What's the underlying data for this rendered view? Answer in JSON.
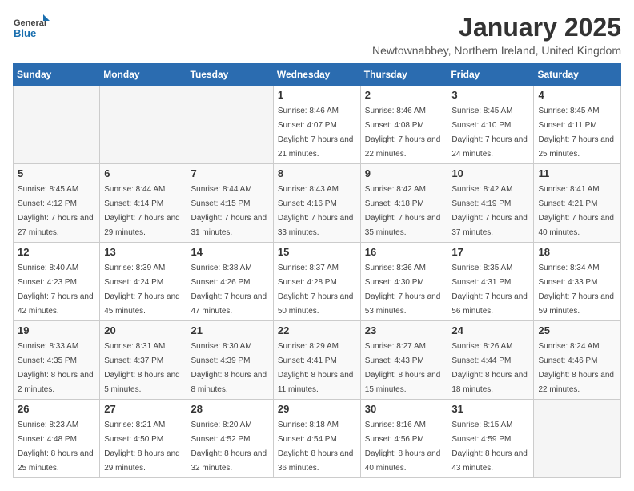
{
  "logo": {
    "general": "General",
    "blue": "Blue"
  },
  "title": "January 2025",
  "subtitle": "Newtownabbey, Northern Ireland, United Kingdom",
  "days_of_week": [
    "Sunday",
    "Monday",
    "Tuesday",
    "Wednesday",
    "Thursday",
    "Friday",
    "Saturday"
  ],
  "weeks": [
    [
      {
        "day": "",
        "sunrise": "",
        "sunset": "",
        "daylight": ""
      },
      {
        "day": "",
        "sunrise": "",
        "sunset": "",
        "daylight": ""
      },
      {
        "day": "",
        "sunrise": "",
        "sunset": "",
        "daylight": ""
      },
      {
        "day": "1",
        "sunrise": "Sunrise: 8:46 AM",
        "sunset": "Sunset: 4:07 PM",
        "daylight": "Daylight: 7 hours and 21 minutes."
      },
      {
        "day": "2",
        "sunrise": "Sunrise: 8:46 AM",
        "sunset": "Sunset: 4:08 PM",
        "daylight": "Daylight: 7 hours and 22 minutes."
      },
      {
        "day": "3",
        "sunrise": "Sunrise: 8:45 AM",
        "sunset": "Sunset: 4:10 PM",
        "daylight": "Daylight: 7 hours and 24 minutes."
      },
      {
        "day": "4",
        "sunrise": "Sunrise: 8:45 AM",
        "sunset": "Sunset: 4:11 PM",
        "daylight": "Daylight: 7 hours and 25 minutes."
      }
    ],
    [
      {
        "day": "5",
        "sunrise": "Sunrise: 8:45 AM",
        "sunset": "Sunset: 4:12 PM",
        "daylight": "Daylight: 7 hours and 27 minutes."
      },
      {
        "day": "6",
        "sunrise": "Sunrise: 8:44 AM",
        "sunset": "Sunset: 4:14 PM",
        "daylight": "Daylight: 7 hours and 29 minutes."
      },
      {
        "day": "7",
        "sunrise": "Sunrise: 8:44 AM",
        "sunset": "Sunset: 4:15 PM",
        "daylight": "Daylight: 7 hours and 31 minutes."
      },
      {
        "day": "8",
        "sunrise": "Sunrise: 8:43 AM",
        "sunset": "Sunset: 4:16 PM",
        "daylight": "Daylight: 7 hours and 33 minutes."
      },
      {
        "day": "9",
        "sunrise": "Sunrise: 8:42 AM",
        "sunset": "Sunset: 4:18 PM",
        "daylight": "Daylight: 7 hours and 35 minutes."
      },
      {
        "day": "10",
        "sunrise": "Sunrise: 8:42 AM",
        "sunset": "Sunset: 4:19 PM",
        "daylight": "Daylight: 7 hours and 37 minutes."
      },
      {
        "day": "11",
        "sunrise": "Sunrise: 8:41 AM",
        "sunset": "Sunset: 4:21 PM",
        "daylight": "Daylight: 7 hours and 40 minutes."
      }
    ],
    [
      {
        "day": "12",
        "sunrise": "Sunrise: 8:40 AM",
        "sunset": "Sunset: 4:23 PM",
        "daylight": "Daylight: 7 hours and 42 minutes."
      },
      {
        "day": "13",
        "sunrise": "Sunrise: 8:39 AM",
        "sunset": "Sunset: 4:24 PM",
        "daylight": "Daylight: 7 hours and 45 minutes."
      },
      {
        "day": "14",
        "sunrise": "Sunrise: 8:38 AM",
        "sunset": "Sunset: 4:26 PM",
        "daylight": "Daylight: 7 hours and 47 minutes."
      },
      {
        "day": "15",
        "sunrise": "Sunrise: 8:37 AM",
        "sunset": "Sunset: 4:28 PM",
        "daylight": "Daylight: 7 hours and 50 minutes."
      },
      {
        "day": "16",
        "sunrise": "Sunrise: 8:36 AM",
        "sunset": "Sunset: 4:30 PM",
        "daylight": "Daylight: 7 hours and 53 minutes."
      },
      {
        "day": "17",
        "sunrise": "Sunrise: 8:35 AM",
        "sunset": "Sunset: 4:31 PM",
        "daylight": "Daylight: 7 hours and 56 minutes."
      },
      {
        "day": "18",
        "sunrise": "Sunrise: 8:34 AM",
        "sunset": "Sunset: 4:33 PM",
        "daylight": "Daylight: 7 hours and 59 minutes."
      }
    ],
    [
      {
        "day": "19",
        "sunrise": "Sunrise: 8:33 AM",
        "sunset": "Sunset: 4:35 PM",
        "daylight": "Daylight: 8 hours and 2 minutes."
      },
      {
        "day": "20",
        "sunrise": "Sunrise: 8:31 AM",
        "sunset": "Sunset: 4:37 PM",
        "daylight": "Daylight: 8 hours and 5 minutes."
      },
      {
        "day": "21",
        "sunrise": "Sunrise: 8:30 AM",
        "sunset": "Sunset: 4:39 PM",
        "daylight": "Daylight: 8 hours and 8 minutes."
      },
      {
        "day": "22",
        "sunrise": "Sunrise: 8:29 AM",
        "sunset": "Sunset: 4:41 PM",
        "daylight": "Daylight: 8 hours and 11 minutes."
      },
      {
        "day": "23",
        "sunrise": "Sunrise: 8:27 AM",
        "sunset": "Sunset: 4:43 PM",
        "daylight": "Daylight: 8 hours and 15 minutes."
      },
      {
        "day": "24",
        "sunrise": "Sunrise: 8:26 AM",
        "sunset": "Sunset: 4:44 PM",
        "daylight": "Daylight: 8 hours and 18 minutes."
      },
      {
        "day": "25",
        "sunrise": "Sunrise: 8:24 AM",
        "sunset": "Sunset: 4:46 PM",
        "daylight": "Daylight: 8 hours and 22 minutes."
      }
    ],
    [
      {
        "day": "26",
        "sunrise": "Sunrise: 8:23 AM",
        "sunset": "Sunset: 4:48 PM",
        "daylight": "Daylight: 8 hours and 25 minutes."
      },
      {
        "day": "27",
        "sunrise": "Sunrise: 8:21 AM",
        "sunset": "Sunset: 4:50 PM",
        "daylight": "Daylight: 8 hours and 29 minutes."
      },
      {
        "day": "28",
        "sunrise": "Sunrise: 8:20 AM",
        "sunset": "Sunset: 4:52 PM",
        "daylight": "Daylight: 8 hours and 32 minutes."
      },
      {
        "day": "29",
        "sunrise": "Sunrise: 8:18 AM",
        "sunset": "Sunset: 4:54 PM",
        "daylight": "Daylight: 8 hours and 36 minutes."
      },
      {
        "day": "30",
        "sunrise": "Sunrise: 8:16 AM",
        "sunset": "Sunset: 4:56 PM",
        "daylight": "Daylight: 8 hours and 40 minutes."
      },
      {
        "day": "31",
        "sunrise": "Sunrise: 8:15 AM",
        "sunset": "Sunset: 4:59 PM",
        "daylight": "Daylight: 8 hours and 43 minutes."
      },
      {
        "day": "",
        "sunrise": "",
        "sunset": "",
        "daylight": ""
      }
    ]
  ]
}
